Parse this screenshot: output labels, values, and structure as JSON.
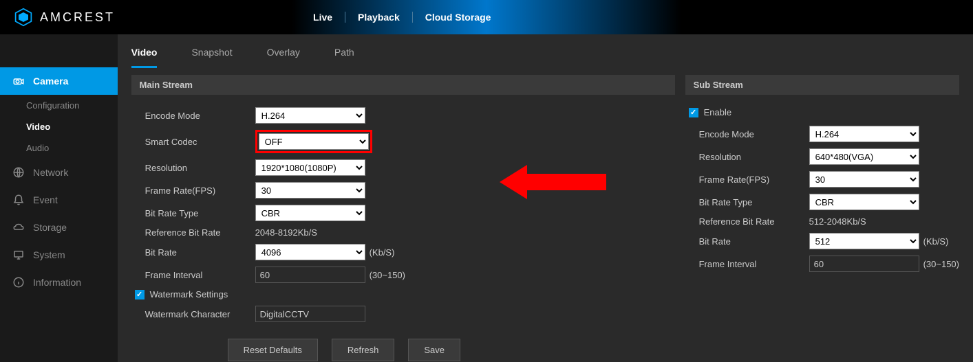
{
  "brand": "AMCREST",
  "topnav": [
    "Live",
    "Playback",
    "Cloud Storage"
  ],
  "sidebar": {
    "camera": "Camera",
    "camera_children": [
      "Configuration",
      "Video",
      "Audio"
    ],
    "network": "Network",
    "event": "Event",
    "storage": "Storage",
    "system": "System",
    "information": "Information"
  },
  "tabs": [
    "Video",
    "Snapshot",
    "Overlay",
    "Path"
  ],
  "main": {
    "header": "Main Stream",
    "encode_mode_label": "Encode Mode",
    "encode_mode_value": "H.264",
    "smart_codec_label": "Smart Codec",
    "smart_codec_value": "OFF",
    "resolution_label": "Resolution",
    "resolution_value": "1920*1080(1080P)",
    "frame_rate_label": "Frame Rate(FPS)",
    "frame_rate_value": "30",
    "bit_rate_type_label": "Bit Rate Type",
    "bit_rate_type_value": "CBR",
    "ref_bit_rate_label": "Reference Bit Rate",
    "ref_bit_rate_value": "2048-8192Kb/S",
    "bit_rate_label": "Bit Rate",
    "bit_rate_value": "4096",
    "bit_rate_suffix": "(Kb/S)",
    "frame_interval_label": "Frame Interval",
    "frame_interval_value": "60",
    "frame_interval_suffix": "(30~150)",
    "watermark_settings_label": "Watermark Settings",
    "watermark_character_label": "Watermark Character",
    "watermark_character_value": "DigitalCCTV"
  },
  "sub": {
    "header": "Sub Stream",
    "enable_label": "Enable",
    "encode_mode_label": "Encode Mode",
    "encode_mode_value": "H.264",
    "resolution_label": "Resolution",
    "resolution_value": "640*480(VGA)",
    "frame_rate_label": "Frame Rate(FPS)",
    "frame_rate_value": "30",
    "bit_rate_type_label": "Bit Rate Type",
    "bit_rate_type_value": "CBR",
    "ref_bit_rate_label": "Reference Bit Rate",
    "ref_bit_rate_value": "512-2048Kb/S",
    "bit_rate_label": "Bit Rate",
    "bit_rate_value": "512",
    "bit_rate_suffix": "(Kb/S)",
    "frame_interval_label": "Frame Interval",
    "frame_interval_value": "60",
    "frame_interval_suffix": "(30~150)"
  },
  "buttons": {
    "reset": "Reset Defaults",
    "refresh": "Refresh",
    "save": "Save"
  }
}
